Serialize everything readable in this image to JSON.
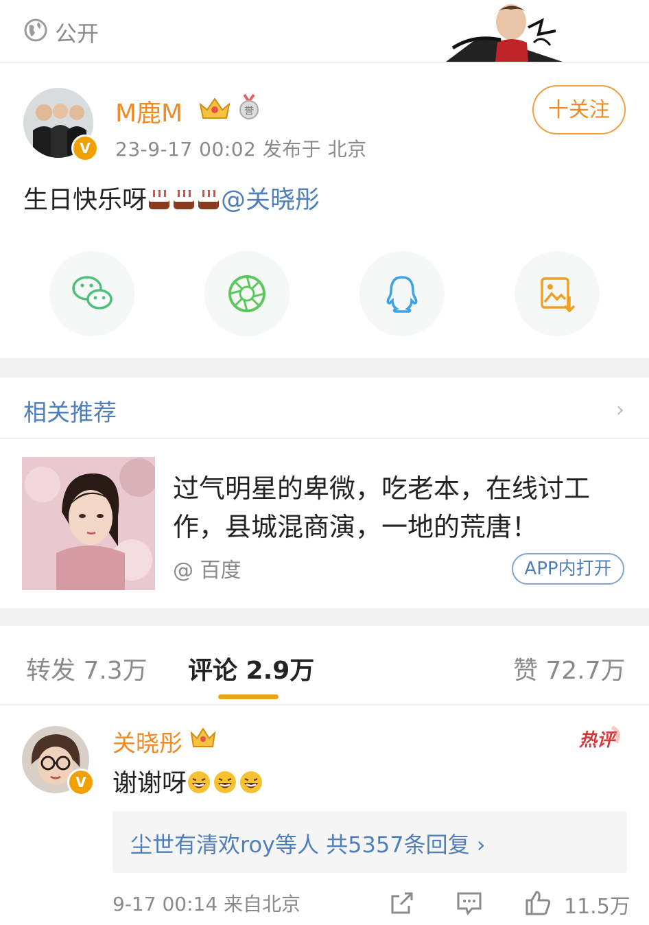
{
  "visibility": {
    "label": "公开",
    "icon": "globe-icon"
  },
  "post": {
    "author": "M鹿M",
    "verified_badge": "V",
    "meta": "23-9-17 00:02  发布于 北京",
    "follow_label": "十关注",
    "text_prefix": "生日快乐呀",
    "mention": "@关晓彤",
    "emoji": "cake-icon"
  },
  "share": {
    "items": [
      {
        "name": "wechat-icon",
        "color": "#4cc07a"
      },
      {
        "name": "moments-icon",
        "color": "#5cc85c"
      },
      {
        "name": "qq-icon",
        "color": "#3aa2e8"
      },
      {
        "name": "save-image-icon",
        "color": "#f0a020"
      }
    ]
  },
  "related": {
    "title": "相关推荐",
    "chevron": "›",
    "headline": "过气明星的卑微，吃老本，在线讨工作，县城混商演，一地的荒唐！",
    "source": "@ 百度",
    "open_app_label": "APP内打开"
  },
  "tabs": {
    "repost": "转发 7.3万",
    "comment": "评论 2.9万",
    "like": "赞 72.7万",
    "accent": "#f0a020"
  },
  "comment": {
    "author": "关晓彤",
    "verified_badge": "V",
    "hot_label": "热评",
    "text": "谢谢呀",
    "reply_summary": "尘世有清欢roy等人  共5357条回复 ›",
    "meta": "9-17 00:14  来自北京",
    "like_count": "11.5万"
  },
  "colors": {
    "orange": "#f08a24",
    "link_blue": "#4f7fb8",
    "gray": "#8a8a8a"
  }
}
